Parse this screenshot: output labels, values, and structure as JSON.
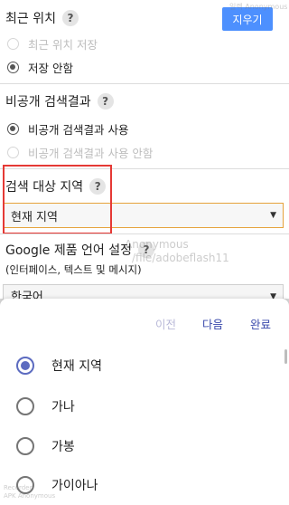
{
  "recent_location": {
    "title": "최근 위치",
    "help_icon": "?",
    "clear_button": "지우기",
    "options": [
      {
        "label": "최근 위치 저장",
        "selected": false,
        "disabled": true
      },
      {
        "label": "저장 안함",
        "selected": true,
        "disabled": false
      }
    ]
  },
  "private_results": {
    "title": "비공개 검색결과",
    "help_icon": "?",
    "options": [
      {
        "label": "비공개 검색결과 사용",
        "selected": true,
        "disabled": false
      },
      {
        "label": "비공개 검색결과 사용 안함",
        "selected": false,
        "disabled": true
      }
    ]
  },
  "search_region": {
    "title": "검색 대상 지역",
    "help_icon": "?",
    "selected_value": "현재 지역",
    "highlight_color": "#e53935"
  },
  "language": {
    "title": "Google 제품 언어 설정",
    "help_icon": "?",
    "subtitle": "(인터페이스, 텍스트 및 메시지)",
    "selected_value": "한국어"
  },
  "watermarks": {
    "top_right": "일렉 Anonymous",
    "mid_line1": "Anonymous",
    "mid_line2": "/file/adobeflash11",
    "bottom_left_1": "Recorded",
    "bottom_left_2": "APK Anonymous"
  },
  "picker": {
    "prev_label": "이전",
    "next_label": "다음",
    "done_label": "완료",
    "options": [
      {
        "label": "현재 지역",
        "selected": true
      },
      {
        "label": "가나",
        "selected": false
      },
      {
        "label": "가봉",
        "selected": false
      },
      {
        "label": "가이아나",
        "selected": false
      }
    ]
  },
  "colors": {
    "accent_button": "#4d90fe",
    "picker_accent": "#5c6bc0",
    "nav_active": "#3949ab"
  }
}
